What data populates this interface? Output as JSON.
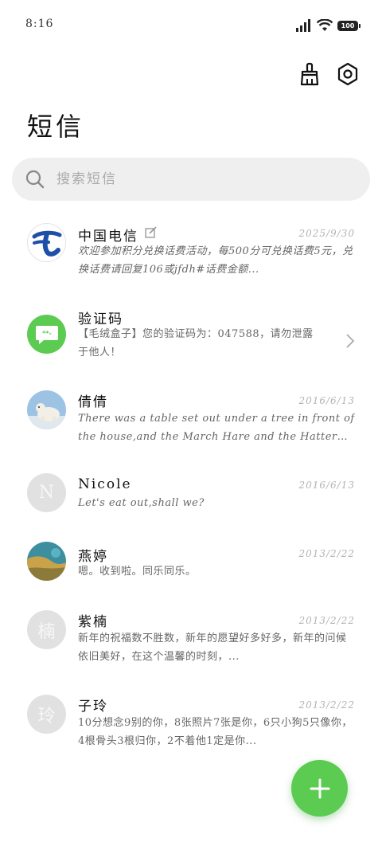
{
  "status_bar": {
    "time": "8:16",
    "battery": "100"
  },
  "header": {
    "title": "短信",
    "clean_icon": "broom-icon",
    "settings_icon": "settings-hexagon-icon"
  },
  "search": {
    "placeholder": "搜索短信"
  },
  "messages": [
    {
      "name": "中国电信",
      "date": "2025/9/30",
      "preview": "欢迎参加积分兑换话费活动，每500分可兑换话费5元，兑换话费请回复106或jfdh#话费金额...",
      "avatar": "china-telecom-logo",
      "edit_icon": true
    },
    {
      "name": "验证码",
      "date": "",
      "preview": "【毛绒盒子】您的验证码为：047588，请勿泄露于他人！",
      "avatar": "verification-code-icon"
    },
    {
      "name": "倩倩",
      "date": "2016/6/13",
      "preview": "There was a table set out under a tree in front of the house,and the March Hare and the Hatter were having ...",
      "avatar": "polar-bear-photo"
    },
    {
      "name": "Nicole",
      "date": "2016/6/13",
      "preview": "Let's eat out,shall we?",
      "avatar_letter": "N"
    },
    {
      "name": "燕婷",
      "date": "2013/2/22",
      "preview": "嗯。收到啦。同乐同乐。",
      "avatar": "landscape-photo"
    },
    {
      "name": "紫楠",
      "date": "2013/2/22",
      "preview": "新年的祝福数不胜数，新年的愿望好多好多，新年的问候依旧美好，在这个温馨的时刻，...",
      "avatar_letter": "楠"
    },
    {
      "name": "子玲",
      "date": "2013/2/22",
      "preview": "10分想念9别的你，8张照片7张是你，6只小狗5只像你，4根骨头3根归你，2不着他1定是你...",
      "avatar_letter": "玲"
    }
  ],
  "fab": {
    "icon": "plus-icon"
  },
  "colors": {
    "accent": "#5ccb51",
    "telecom_blue": "#1e4fa8"
  }
}
